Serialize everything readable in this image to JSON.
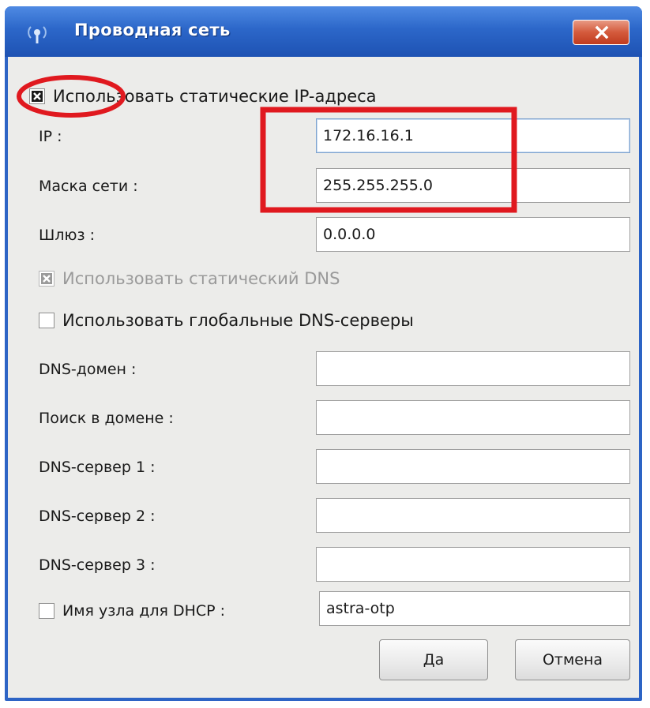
{
  "window": {
    "title": "Проводная сеть",
    "title_icon": "network-antenna-icon",
    "close_icon": "close-icon"
  },
  "static_ip": {
    "label": "Использовать статические IP-адреса",
    "checked": true
  },
  "ip": {
    "label": "IP :",
    "value": "172.16.16.1"
  },
  "netmask": {
    "label": "Маска сети :",
    "value": "255.255.255.0"
  },
  "gateway": {
    "label": "Шлюз :",
    "value": "0.0.0.0"
  },
  "static_dns": {
    "label": "Использовать статический DNS",
    "checked": true,
    "disabled": true
  },
  "global_dns": {
    "label": "Использовать глобальные DNS-серверы",
    "checked": false
  },
  "dns_domain": {
    "label": "DNS-домен :",
    "value": ""
  },
  "search_domain": {
    "label": "Поиск в домене :",
    "value": ""
  },
  "dns1": {
    "label": "DNS-сервер 1 :",
    "value": ""
  },
  "dns2": {
    "label": "DNS-сервер 2 :",
    "value": ""
  },
  "dns3": {
    "label": "DNS-сервер 3 :",
    "value": ""
  },
  "dhcp_hostname": {
    "label": "Имя узла для DHCP :",
    "checked": false,
    "value": "astra-otp"
  },
  "buttons": {
    "ok": "Да",
    "cancel": "Отмена"
  },
  "colors": {
    "titlebar": "#2c67c9",
    "client_bg": "#ececea",
    "annotation_red": "#e0191f"
  }
}
